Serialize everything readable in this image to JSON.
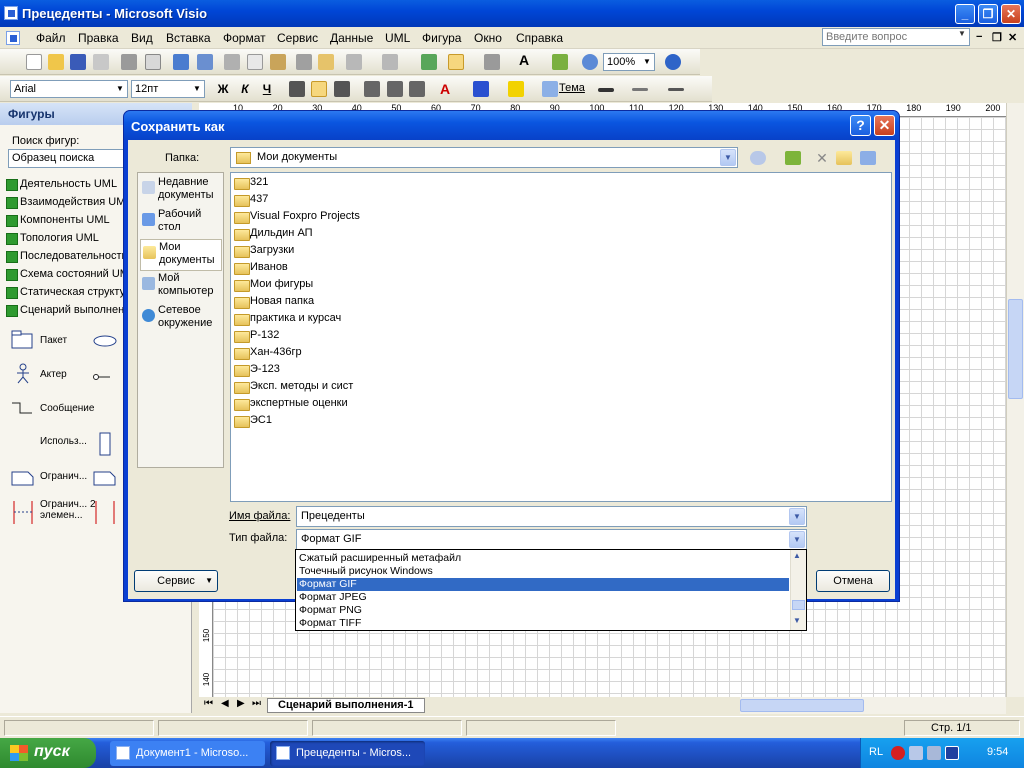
{
  "window": {
    "title": "Прецеденты - Microsoft Visio",
    "minimize": "_",
    "restore": "❐",
    "close": "✕"
  },
  "menu": {
    "items": [
      "Файл",
      "Правка",
      "Вид",
      "Вставка",
      "Формат",
      "Сервис",
      "Данные",
      "UML",
      "Фигура",
      "Окно",
      "Справка"
    ],
    "help_placeholder": "Введите вопрос",
    "doc_minimize": "−",
    "doc_restore": "❐",
    "doc_close": "✕"
  },
  "toolbar": {
    "zoom": "100%",
    "font": "Arial",
    "font_size": "12пт",
    "bold": "Ж",
    "italic": "К",
    "underline": "Ч",
    "theme": "Тема"
  },
  "shapes_panel": {
    "title": "Фигуры",
    "search_label": "Поиск фигур:",
    "search_placeholder": "Образец поиска",
    "stencils": [
      "Деятельность UML",
      "Взаимодействия UML",
      "Компоненты UML",
      "Топология UML",
      "Последовательность",
      "Схема состояний UML",
      "Статическая структура",
      "Сценарий выполнения"
    ],
    "shapes": [
      "Пакет",
      "Актер",
      "Сообщение",
      "Использ...",
      "Огранич...",
      "Огранич... 2 элемен..."
    ]
  },
  "ruler": {
    "top": [
      "10",
      "20",
      "30",
      "40",
      "50",
      "60",
      "70",
      "80",
      "90",
      "100",
      "110",
      "120",
      "130",
      "140",
      "150",
      "160",
      "170",
      "180",
      "190",
      "200"
    ],
    "left": [
      "150",
      "140"
    ]
  },
  "page_tab": "Сценарий выполнения-1",
  "status": {
    "page": "Стр. 1/1"
  },
  "taskbar": {
    "start": "пуск",
    "buttons": [
      "Документ1 - Microso...",
      "Прецеденты - Micros..."
    ],
    "lang": "RL",
    "time": "9:54"
  },
  "dialog": {
    "title": "Сохранить как",
    "help": "?",
    "close": "✕",
    "folder_label": "Папка:",
    "folder_value": "Мои документы",
    "places": [
      "Недавние документы",
      "Рабочий стол",
      "Мои документы",
      "Мой компьютер",
      "Сетевое окружение"
    ],
    "files": [
      "321",
      "437",
      "Visual Foxpro Projects",
      "Дильдин АП",
      "Загрузки",
      "Иванов",
      "Мои фигуры",
      "Новая папка",
      "практика и курсач",
      "Р-132",
      "Хан-436гр",
      "Э-123",
      "Эксп. методы и сист",
      "экспертные оценки",
      "ЭС1"
    ],
    "filename_label": "Имя файла:",
    "filename_value": "Прецеденты",
    "filetype_label": "Тип файла:",
    "filetype_value": "Формат GIF",
    "filetype_options": [
      "Сжатый расширенный метафайл",
      "Точечный рисунок Windows",
      "Формат GIF",
      "Формат JPEG",
      "Формат PNG",
      "Формат TIFF"
    ],
    "selected_option": "Формат GIF",
    "service_button": "Сервис",
    "cancel_button": "Отмена"
  },
  "colors": {
    "title_blue": "#0a55e0",
    "select_blue": "#316ac5",
    "start_green": "#3a9c3a",
    "xp_face": "#ece9d8"
  }
}
